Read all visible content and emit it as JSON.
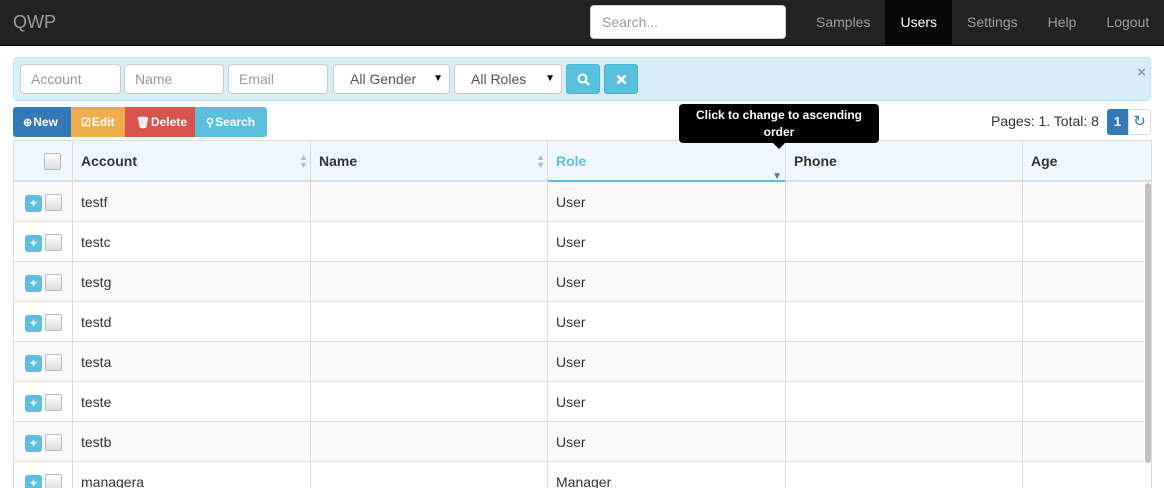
{
  "navbar": {
    "brand": "QWP",
    "search_placeholder": "Search...",
    "links": [
      {
        "label": "Samples",
        "active": false
      },
      {
        "label": "Users",
        "active": true
      },
      {
        "label": "Settings",
        "active": false
      },
      {
        "label": "Help",
        "active": false
      },
      {
        "label": "Logout",
        "active": false
      }
    ]
  },
  "filters": {
    "account_placeholder": "Account",
    "name_placeholder": "Name",
    "email_placeholder": "Email",
    "gender_value": "All Gender",
    "roles_value": "All Roles",
    "search_icon": "search-icon",
    "clear_icon": "times-icon",
    "close_glyph": "×"
  },
  "toolbar": {
    "new_label": "New",
    "edit_label": "Edit",
    "delete_label": "Delete",
    "search_label": "Search"
  },
  "pagination": {
    "info": "Pages: 1. Total: 8",
    "current_page": "1"
  },
  "tooltip": {
    "text": "Click to change to ascending order"
  },
  "table": {
    "columns": [
      "Account",
      "Name",
      "Role",
      "Phone",
      "Age"
    ],
    "sorted_column": "Role",
    "rows": [
      {
        "account": "testf",
        "name": "",
        "role": "User",
        "phone": "",
        "age": ""
      },
      {
        "account": "testc",
        "name": "",
        "role": "User",
        "phone": "",
        "age": ""
      },
      {
        "account": "testg",
        "name": "",
        "role": "User",
        "phone": "",
        "age": ""
      },
      {
        "account": "testd",
        "name": "",
        "role": "User",
        "phone": "",
        "age": ""
      },
      {
        "account": "testa",
        "name": "",
        "role": "User",
        "phone": "",
        "age": ""
      },
      {
        "account": "teste",
        "name": "",
        "role": "User",
        "phone": "",
        "age": ""
      },
      {
        "account": "testb",
        "name": "",
        "role": "User",
        "phone": "",
        "age": ""
      },
      {
        "account": "managera",
        "name": "",
        "role": "Manager",
        "phone": "",
        "age": ""
      }
    ]
  },
  "colors": {
    "navbar_bg": "#222222",
    "primary": "#337ab7",
    "warning": "#f0ad4e",
    "danger": "#d9534f",
    "info": "#5bc0de"
  }
}
